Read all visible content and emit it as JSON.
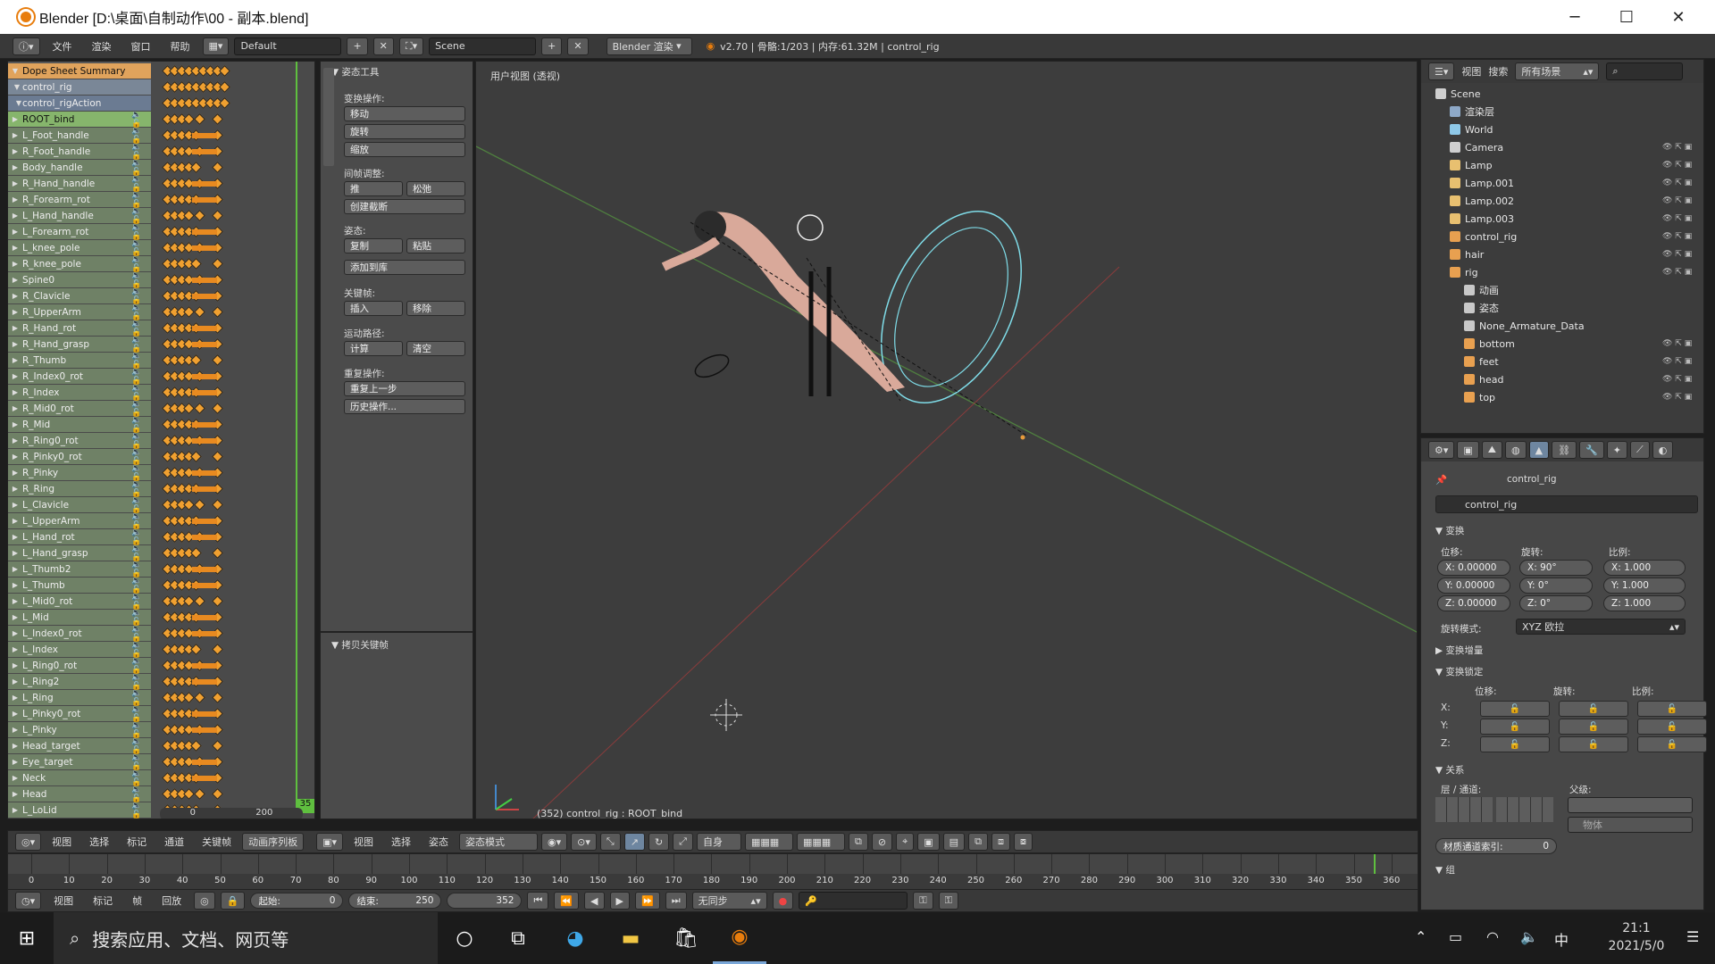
{
  "window": {
    "title": "Blender [D:\\桌面\\自制动作\\00 - 副本.blend]",
    "minimize": "─",
    "maximize": "☐",
    "close": "✕"
  },
  "infobar": {
    "menus": [
      "文件",
      "渲染",
      "窗口",
      "帮助"
    ],
    "layout": "Default",
    "scene": "Scene",
    "engine": "Blender 渲染",
    "stats": "v2.70 | 骨骼:1/203 | 内存:61.32M | control_rig"
  },
  "dopesheet": {
    "channels": [
      "Dope Sheet Summary",
      "control_rig",
      "control_rigAction",
      "ROOT_bind",
      "L_Foot_handle",
      "R_Foot_handle",
      "Body_handle",
      "R_Hand_handle",
      "R_Forearm_rot",
      "L_Hand_handle",
      "L_Forearm_rot",
      "L_knee_pole",
      "R_knee_pole",
      "Spine0",
      "R_Clavicle",
      "R_UpperArm",
      "R_Hand_rot",
      "R_Hand_grasp",
      "R_Thumb",
      "R_Index0_rot",
      "R_Index",
      "R_Mid0_rot",
      "R_Mid",
      "R_Ring0_rot",
      "R_Pinky0_rot",
      "R_Pinky",
      "R_Ring",
      "L_Clavicle",
      "L_UpperArm",
      "L_Hand_rot",
      "L_Hand_grasp",
      "L_Thumb2",
      "L_Thumb",
      "L_Mid0_rot",
      "L_Mid",
      "L_Index0_rot",
      "L_Index",
      "L_Ring0_rot",
      "L_Ring2",
      "L_Ring",
      "L_Pinky0_rot",
      "L_Pinky",
      "Head_target",
      "Eye_target",
      "Neck",
      "Head",
      "L_LoLid"
    ],
    "ruler": [
      "0",
      "200"
    ],
    "frame_marker": "35",
    "menus": [
      "视图",
      "选择",
      "标记",
      "通道",
      "关键帧"
    ],
    "mode": "动画序列板"
  },
  "toolshelf": {
    "title": "▼ 姿态工具",
    "sections": {
      "transform": "变换操作:",
      "inbetween": "间帧调整:",
      "pose": "姿态:",
      "keyframes": "关键帧:",
      "motionpath": "运动路径:",
      "repeat": "重复操作:"
    },
    "buttons": {
      "move": "移动",
      "rotate": "旋转",
      "scale": "缩放",
      "push": "推",
      "relax": "松弛",
      "breakdown": "创建截断",
      "copy": "复制",
      "paste": "粘贴",
      "addlib": "添加到库",
      "insert": "插入",
      "remove": "移除",
      "calc": "计算",
      "clear": "清空",
      "redo": "重复上一步",
      "history": "历史操作..."
    },
    "copykeys": "▼ 拷贝关键帧"
  },
  "viewport": {
    "label": "用户视图 (透视)",
    "status": "(352) control_rig : ROOT_bind",
    "header": {
      "menus": [
        "视图",
        "选择",
        "姿态"
      ],
      "mode": "姿态模式",
      "pivot": "自身"
    }
  },
  "outliner": {
    "menus": [
      "视图",
      "搜索"
    ],
    "filter": "所有场景",
    "items": [
      "Scene",
      "渲染层",
      "World",
      "Camera",
      "Lamp",
      "Lamp.001",
      "Lamp.002",
      "Lamp.003",
      "control_rig",
      "hair",
      "rig",
      "动画",
      "姿态",
      "None_Armature_Data",
      "bottom",
      "feet",
      "head",
      "top"
    ]
  },
  "properties": {
    "context": "control_rig",
    "object_name": "control_rig",
    "transform": "▼ 变换",
    "loc": "位移:",
    "rot": "旋转:",
    "scale": "比例:",
    "loc_vals": [
      "X: 0.00000",
      "Y: 0.00000",
      "Z: 0.00000"
    ],
    "rot_vals": [
      "X: 90°",
      "Y: 0°",
      "Z: 0°"
    ],
    "scale_vals": [
      "X: 1.000",
      "Y: 1.000",
      "Z: 1.000"
    ],
    "rotmode_label": "旋转模式:",
    "rotmode": "XYZ 欧拉",
    "delta": "▶ 变换增量",
    "locks": "▼ 变换锁定",
    "lock_axes": [
      "X:",
      "Y:",
      "Z:"
    ],
    "relations": "▼ 关系",
    "layers": "层 / 通道:",
    "parent": "父级:",
    "parent_type": "物体",
    "passidx": "材质通道索引:",
    "passidx_val": "0",
    "group": "▼ 组"
  },
  "timeline": {
    "ticks": [
      "0",
      "10",
      "20",
      "30",
      "40",
      "50",
      "60",
      "70",
      "80",
      "90",
      "100",
      "110",
      "120",
      "130",
      "140",
      "150",
      "160",
      "170",
      "180",
      "190",
      "200",
      "210",
      "220",
      "230",
      "240",
      "250",
      "260",
      "270",
      "280",
      "290",
      "300",
      "310",
      "320",
      "330",
      "340",
      "350",
      "360"
    ],
    "menus": [
      "视图",
      "标记",
      "帧",
      "回放"
    ],
    "start": "起始:",
    "start_val": "0",
    "end": "结束:",
    "end_val": "250",
    "current": "352",
    "sync": "无同步"
  },
  "taskbar": {
    "search": "搜索应用、文档、网页等",
    "time": "21:1",
    "date": "2021/5/0",
    "ime": "中"
  }
}
